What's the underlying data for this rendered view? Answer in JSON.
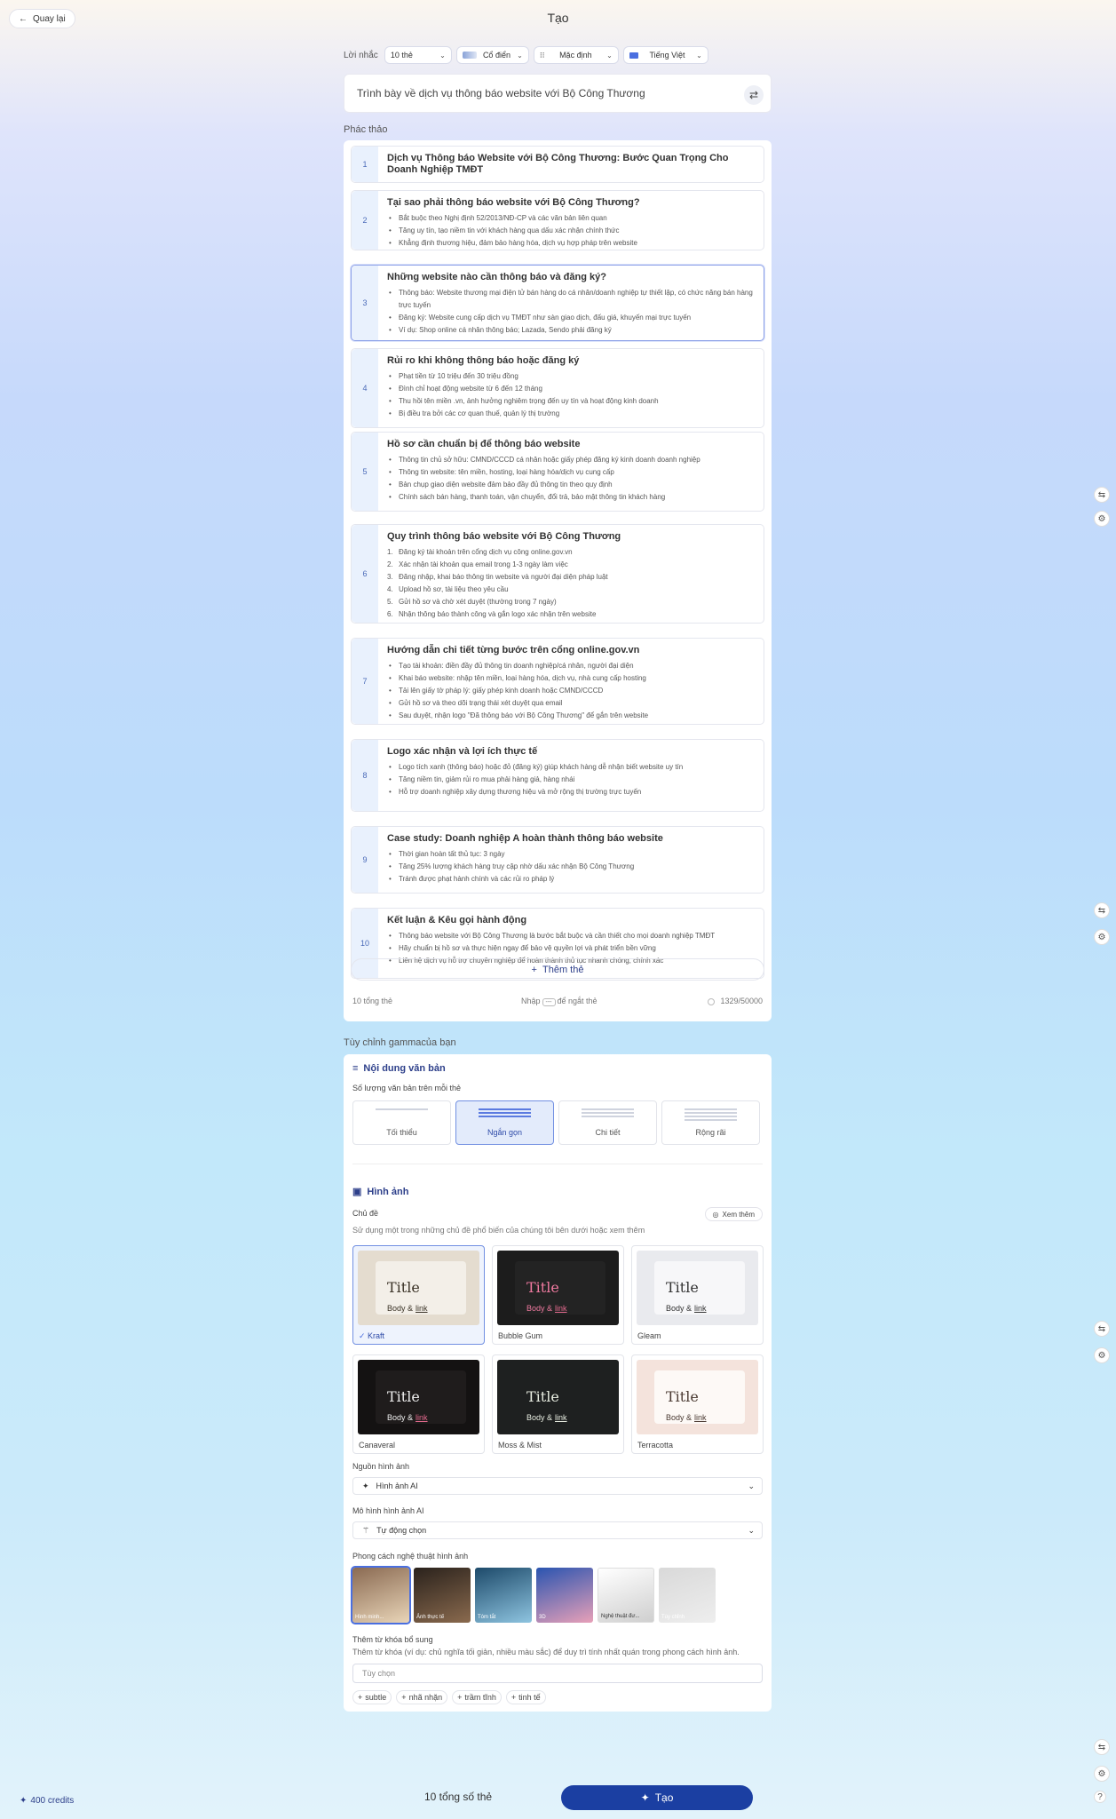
{
  "header": {
    "back_label": "Quay lại",
    "title": "Tạo"
  },
  "prompt_bar": {
    "label": "Lời nhắc",
    "cards": "10 thẻ",
    "theme": "Cổ điển",
    "layout": "Mặc định",
    "language": "Tiếng Việt"
  },
  "prompt": {
    "text": "Trình bày về dịch vụ thông báo website với Bộ Công Thương"
  },
  "outline": {
    "label": "Phác thảo",
    "cards": [
      {
        "n": "1",
        "title": "Dịch vụ Thông báo Website với Bộ Công Thương: Bước Quan Trọng Cho Doanh Nghiệp TMĐT",
        "bullets": []
      },
      {
        "n": "2",
        "title": "Tại sao phải thông báo website với Bộ Công Thương?",
        "bullets": [
          "Bắt buộc theo Nghị định 52/2013/NĐ-CP và các văn bản liên quan",
          "Tăng uy tín, tạo niềm tin với khách hàng qua dấu xác nhận chính thức",
          "Khẳng định thương hiệu, đảm bảo hàng hóa, dịch vụ hợp pháp trên website"
        ]
      },
      {
        "n": "3",
        "title": "Những website nào cần thông báo và đăng ký?",
        "bullets": [
          "Thông báo: Website thương mại điện tử bán hàng do cá nhân/doanh nghiệp tự thiết lập, có chức năng bán hàng trực tuyến",
          "Đăng ký: Website cung cấp dịch vụ TMĐT như sàn giao dịch, đấu giá, khuyến mại trực tuyến",
          "Ví dụ: Shop online cá nhân thông báo; Lazada, Sendo phải đăng ký"
        ]
      },
      {
        "n": "4",
        "title": "Rủi ro khi không thông báo hoặc đăng ký",
        "bullets": [
          "Phạt tiền từ 10 triệu đến 30 triệu đồng",
          "Đình chỉ hoạt động website từ 6 đến 12 tháng",
          "Thu hồi tên miền .vn, ảnh hưởng nghiêm trọng đến uy tín và hoạt động kinh doanh",
          "Bị điều tra bởi các cơ quan thuế, quản lý thị trường"
        ]
      },
      {
        "n": "5",
        "title": "Hồ sơ cần chuẩn bị để thông báo website",
        "bullets": [
          "Thông tin chủ sở hữu: CMND/CCCD cá nhân hoặc giấy phép đăng ký kinh doanh doanh nghiệp",
          "Thông tin website: tên miền, hosting, loại hàng hóa/dịch vụ cung cấp",
          "Bản chụp giao diện website đảm bảo đầy đủ thông tin theo quy định",
          "Chính sách bán hàng, thanh toán, vận chuyển, đổi trả, bảo mật thông tin khách hàng"
        ]
      },
      {
        "n": "6",
        "title": "Quy trình thông báo website với Bộ Công Thương",
        "ordered": true,
        "bullets": [
          "Đăng ký tài khoản trên cổng dịch vụ công online.gov.vn",
          "Xác nhận tài khoản qua email trong 1-3 ngày làm việc",
          "Đăng nhập, khai báo thông tin website và người đại diện pháp luật",
          "Upload hồ sơ, tài liệu theo yêu cầu",
          "Gửi hồ sơ và chờ xét duyệt (thường trong 7 ngày)",
          "Nhận thông báo thành công và gắn logo xác nhận trên website"
        ]
      },
      {
        "n": "7",
        "title": "Hướng dẫn chi tiết từng bước trên cổng online.gov.vn",
        "bullets": [
          "Tạo tài khoản: điền đầy đủ thông tin doanh nghiệp/cá nhân, người đại diện",
          "Khai báo website: nhập tên miền, loại hàng hóa, dịch vụ, nhà cung cấp hosting",
          "Tải lên giấy tờ pháp lý: giấy phép kinh doanh hoặc CMND/CCCD",
          "Gửi hồ sơ và theo dõi trạng thái xét duyệt qua email",
          "Sau duyệt, nhận logo \"Đã thông báo với Bộ Công Thương\" để gắn trên website"
        ]
      },
      {
        "n": "8",
        "title": "Logo xác nhận và lợi ích thực tế",
        "bullets": [
          "Logo tích xanh (thông báo) hoặc đỏ (đăng ký) giúp khách hàng dễ nhận biết website uy tín",
          "Tăng niềm tin, giảm rủi ro mua phải hàng giả, hàng nhái",
          "Hỗ trợ doanh nghiệp xây dựng thương hiệu và mở rộng thị trường trực tuyến"
        ]
      },
      {
        "n": "9",
        "title": "Case study: Doanh nghiệp A hoàn thành thông báo website",
        "bullets": [
          "Thời gian hoàn tất thủ tục: 3 ngày",
          "Tăng 25% lượng khách hàng truy cập nhờ dấu xác nhận Bộ Công Thương",
          "Tránh được phạt hành chính và các rủi ro pháp lý"
        ]
      },
      {
        "n": "10",
        "title": "Kết luận & Kêu gọi hành động",
        "bullets": [
          "Thông báo website với Bộ Công Thương là bước bắt buộc và cần thiết cho mọi doanh nghiệp TMĐT",
          "Hãy chuẩn bị hồ sơ và thực hiện ngay để bảo vệ quyền lợi và phát triển bền vững",
          "Liên hệ dịch vụ hỗ trợ chuyên nghiệp để hoàn thành thủ tục nhanh chóng, chính xác"
        ]
      }
    ],
    "add_card": "Thêm thẻ",
    "total_cards": "10 tổng thẻ",
    "hint_prefix": "Nhập",
    "hint_key": "---",
    "hint_suffix": "để ngắt thẻ",
    "char_count": "1329/50000"
  },
  "customize": {
    "label": "Tùy chỉnh gammacủa bạn",
    "text_content": {
      "heading": "Nội dung văn bản",
      "amount_label": "Số lượng văn bản trên mỗi thẻ",
      "options": [
        "Tối thiểu",
        "Ngắn gọn",
        "Chi tiết",
        "Rộng rãi"
      ],
      "selected": "Ngắn gọn"
    },
    "images": {
      "heading": "Hình ảnh",
      "theme_label": "Chủ đề",
      "theme_desc": "Sử dụng một trong những chủ đề phổ biến của chúng tôi bên dưới hoặc xem thêm",
      "see_more": "Xem thêm",
      "themes": [
        {
          "name": "Kraft",
          "title": "Title",
          "body": "Body &",
          "link": "link",
          "bg": "#e4dccf",
          "inner": "#f3efe8",
          "tc": "#3a3226"
        },
        {
          "name": "Bubble Gum",
          "title": "Title",
          "body": "Body &",
          "link": "link",
          "bg": "#1c1c1c",
          "inner": "#232323",
          "tc": "#f07aa0"
        },
        {
          "name": "Gleam",
          "title": "Title",
          "body": "Body &",
          "link": "link",
          "bg": "#e9eaee",
          "inner": "#f7f7f9",
          "tc": "#333"
        },
        {
          "name": "Canaveral",
          "title": "Title",
          "body": "Body &",
          "link": "link",
          "bg": "#141212",
          "inner": "#1f1c1c",
          "tc": "#eee"
        },
        {
          "name": "Moss & Mist",
          "title": "Title",
          "body": "Body &",
          "link": "link",
          "bg": "#1e2020",
          "inner": "#1e2020",
          "tc": "#e9eee2"
        },
        {
          "name": "Terracotta",
          "title": "Title",
          "body": "Body &",
          "link": "link",
          "bg": "#f4e3dc",
          "inner": "#fdf9f6",
          "tc": "#4a3a32"
        }
      ],
      "selected_theme": "Kraft",
      "source_label": "Nguồn hình ảnh",
      "source_value": "Hình ảnh AI",
      "model_label": "Mô hình hình ảnh AI",
      "model_value": "Tự động chọn",
      "style_label": "Phong cách nghệ thuật hình ảnh",
      "styles": [
        {
          "name": "Hình minh...",
          "c1": "#8a6a52",
          "c2": "#e9d5b8"
        },
        {
          "name": "Ảnh thực tế",
          "c1": "#2a221c",
          "c2": "#8a6a4e"
        },
        {
          "name": "Tóm tắt",
          "c1": "#1d4a6a",
          "c2": "#8ec4e0"
        },
        {
          "name": "3D",
          "c1": "#2a54b0",
          "c2": "#e8a0b8"
        },
        {
          "name": "Nghệ thuật đư...",
          "c1": "#ffffff",
          "c2": "#cfcfcf"
        },
        {
          "name": "Tùy chỉnh",
          "c1": "#d9d9d9",
          "c2": "#eeeeee"
        }
      ],
      "keywords_label": "Thêm từ khóa bổ sung",
      "keywords_desc": "Thêm từ khóa (ví dụ: chủ nghĩa tối giản, nhiều màu sắc) để duy trì tính nhất quán trong phong cách hình ảnh.",
      "keywords_placeholder": "Tùy chọn",
      "chips": [
        "subtle",
        "nhã nhặn",
        "trầm tĩnh",
        "tinh tế"
      ]
    }
  },
  "bottom": {
    "credits": "400 credits",
    "total": "10 tổng số thẻ",
    "create": "Tạo"
  },
  "colors": {
    "primary": "#1b3fa2",
    "accent": "#4a6fe0"
  }
}
